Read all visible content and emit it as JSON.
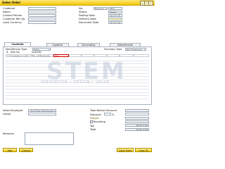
{
  "window": {
    "title": "Sales Order",
    "min_glyph": "▁",
    "max_glyph": "□",
    "close_glyph": "×"
  },
  "header_left": [
    {
      "label": "Customer",
      "value": ""
    },
    {
      "label": "Name",
      "value": ""
    },
    {
      "label": "Contact Person",
      "value": ""
    },
    {
      "label": "Customer Ref. No.",
      "value": ""
    },
    {
      "label": "Local Currency",
      "value": ""
    }
  ],
  "header_right": {
    "no_label": "No.",
    "no_series": "Primary",
    "no_value": "363",
    "status_label": "Status",
    "status_value": "Open",
    "posting_label": "Posting Date",
    "posting_value": "10.03.20",
    "delivery_label": "Delivery Date",
    "delivery_value": "",
    "document_label": "Document Date",
    "document_value": "10.03.20"
  },
  "tabs": [
    "Contents",
    "Logistics",
    "Accounting",
    "Attachments"
  ],
  "contents": {
    "item_type_label": "Item/Service Type",
    "item_type_value": "Item",
    "summary_type_label": "Summary Type",
    "summary_type_value": "No Summary",
    "columns": [
      "#",
      "Item No.",
      "Quantity",
      "",
      "",
      "",
      "",
      "",
      "",
      ""
    ],
    "row": [
      "1",
      "Inventory (unit)",
      "No. of Packages",
      "Qty",
      "",
      "",
      "",
      "",
      "",
      ""
    ]
  },
  "watermark": {
    "big": "STEM",
    "sub": "INNOVATION • DESIGN • VALUE"
  },
  "footer_left": {
    "sales_employee_label": "Sales Employee",
    "sales_employee_value": "-No Sales Employee-",
    "owner_label": "Owner",
    "owner_value": "",
    "remarks_label": "Remarks"
  },
  "footer_right": {
    "total_before_discount_label": "Total Before Discount",
    "total_before_discount_value": "",
    "discount_label": "Discount",
    "discount_pct": "%",
    "freight_label": "Freight",
    "rounding_label": "Rounding",
    "rounding_value": "",
    "tax_label": "Tax",
    "tax_value": "KUD 0.00",
    "total_label": "Total",
    "total_value": "KUD 0.00"
  },
  "buttons": {
    "add": "Add",
    "cancel": "Cancel",
    "copy_from": "Copy From",
    "copy_to": "Copy To"
  }
}
